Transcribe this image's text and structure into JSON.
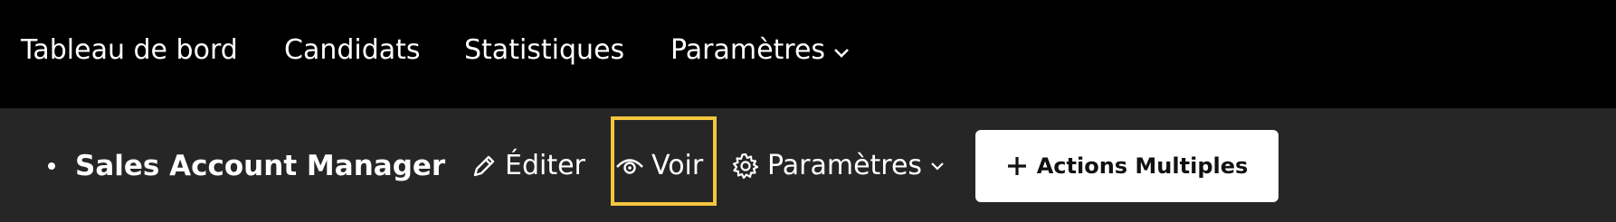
{
  "topnav": {
    "items": [
      {
        "label": "Tableau de bord"
      },
      {
        "label": "Candidats"
      },
      {
        "label": "Statistiques"
      },
      {
        "label": "Paramètres"
      }
    ]
  },
  "subbar": {
    "job_title": "Sales Account Manager",
    "actions": {
      "edit_label": "Éditer",
      "view_label": "Voir",
      "settings_label": "Paramètres"
    },
    "multi_actions_label": "Actions Multiples"
  },
  "colors": {
    "topnav_bg": "#000000",
    "subbar_bg": "#262626",
    "highlight": "#f4c63d",
    "button_bg": "#ffffff"
  },
  "icons": [
    "chevron-down-icon",
    "pencil-icon",
    "eye-icon",
    "gear-icon",
    "plus-icon"
  ]
}
